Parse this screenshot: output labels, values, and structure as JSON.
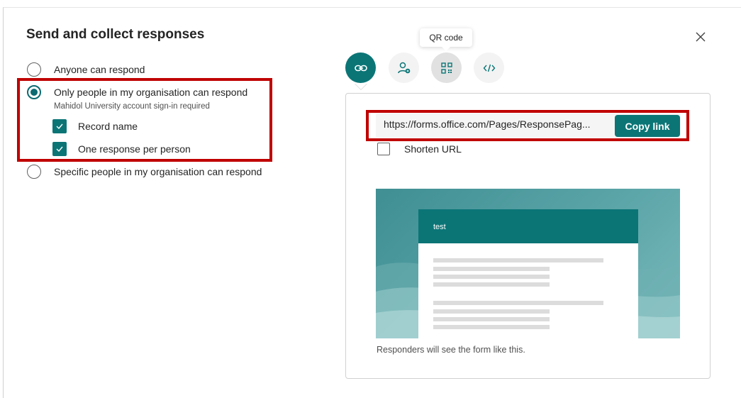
{
  "dialog": {
    "title": "Send and collect responses",
    "close_icon": "close-icon"
  },
  "options": [
    {
      "label": "Anyone can respond",
      "selected": false
    },
    {
      "label": "Only people in my organisation can respond",
      "selected": true,
      "sublabel": "Mahidol University account sign-in required"
    },
    {
      "label": "Specific people in my organisation can respond",
      "selected": false
    }
  ],
  "org_settings": [
    {
      "label": "Record name",
      "checked": true
    },
    {
      "label": "One response per person",
      "checked": true
    }
  ],
  "share_tabs": [
    {
      "name": "link",
      "icon": "link-icon",
      "active": true
    },
    {
      "name": "invite",
      "icon": "person-add-icon",
      "active": false
    },
    {
      "name": "qr",
      "icon": "qr-code-icon",
      "active": false,
      "tooltip": "QR code"
    },
    {
      "name": "embed",
      "icon": "code-icon",
      "active": false
    }
  ],
  "link_panel": {
    "url": "https://forms.office.com/Pages/ResponsePag...",
    "copy_label": "Copy link",
    "shorten_label": "Shorten URL",
    "shorten_checked": false
  },
  "preview": {
    "form_title": "test",
    "caption": "Responders will see the form like this."
  },
  "colors": {
    "accent": "#0b7576",
    "highlight": "#c00000"
  }
}
